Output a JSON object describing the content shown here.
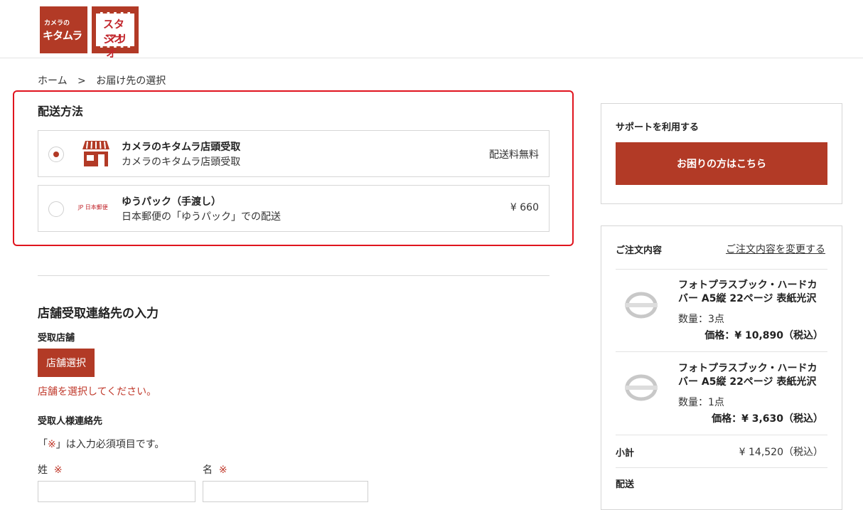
{
  "header": {
    "logo1": {
      "line1": "カメラの",
      "line2": "キタムラ"
    },
    "logo2": {
      "line1": "スタジオ",
      "line2": "マリオ"
    }
  },
  "breadcrumb": {
    "home": "ホーム",
    "sep": ">",
    "current": "お届け先の選択"
  },
  "shipping": {
    "title": "配送方法",
    "options": [
      {
        "title": "カメラのキタムラ店頭受取",
        "subtitle": "カメラのキタムラ店頭受取",
        "price": "配送料無料",
        "selected": true,
        "icon": "store-icon"
      },
      {
        "title": "ゆうパック（手渡し）",
        "subtitle": "日本郵便の「ゆうパック」での配送",
        "price": "¥ 660",
        "selected": false,
        "icon": "japan-post-logo",
        "icon_text": "JP 日本郵便"
      }
    ]
  },
  "store_contact": {
    "title": "店舗受取連絡先の入力",
    "store_label": "受取店舗",
    "store_button": "店舗選択",
    "error": "店舗を選択してください。",
    "recipient_label": "受取人様連絡先",
    "required_note_open": "「",
    "required_mark": "※",
    "required_note_close": "」は入力必須項目です。",
    "last_name_label": "姓",
    "first_name_label": "名"
  },
  "support": {
    "title": "サポートを利用する",
    "button": "お困りの方はこちら"
  },
  "order": {
    "title": "ご注文内容",
    "change_link": "ご注文内容を変更する",
    "items": [
      {
        "name_line1": "フォトプラスブック・ハードカ",
        "name_line2": "バー A5縦 22ページ 表紙光沢",
        "qty": "数量：3点",
        "price": "価格：¥ 10,890（税込）"
      },
      {
        "name_line1": "フォトプラスブック・ハードカ",
        "name_line2": "バー A5縦 22ページ 表紙光沢",
        "qty": "数量：1点",
        "price": "価格：¥ 3,630（税込）"
      }
    ],
    "subtotal_label": "小計",
    "subtotal_value": "¥ 14,520（税込）",
    "shipping_label": "配送"
  },
  "colors": {
    "brand": "#b23a26",
    "highlight": "#e0141e",
    "required": "#c0392b"
  }
}
